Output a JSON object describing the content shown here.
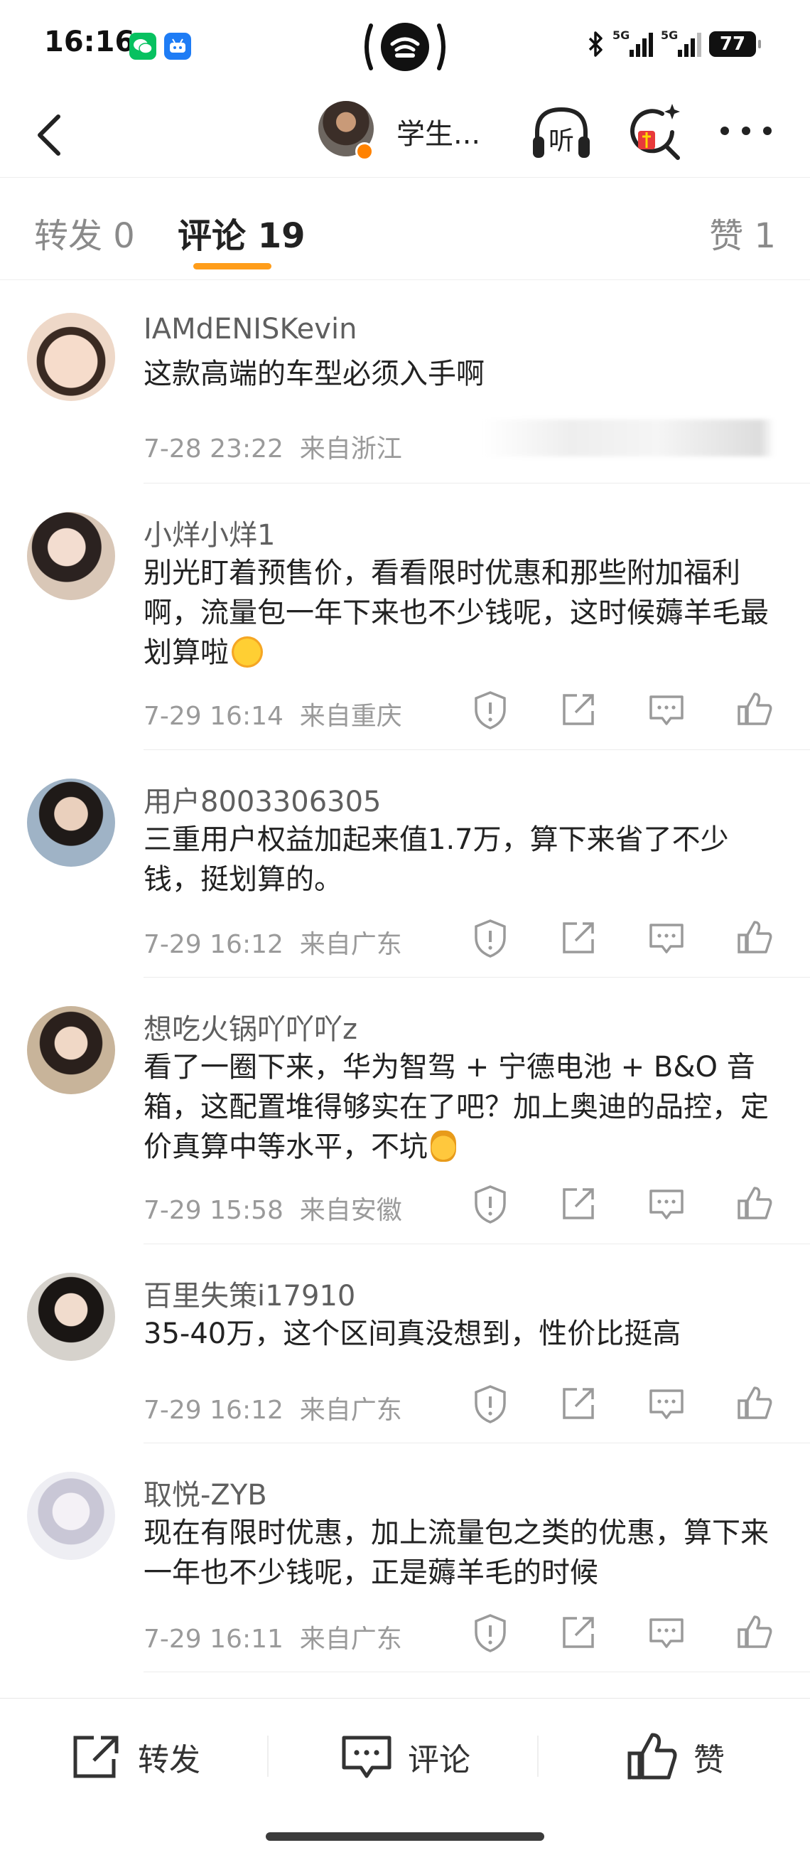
{
  "status_bar": {
    "time": "16:16",
    "network_1": "5G",
    "network_2": "5G",
    "battery": "77"
  },
  "nav": {
    "title": "学生...",
    "listen_label": "听"
  },
  "tabs": {
    "repost": "转发 0",
    "comment": "评论 19",
    "like": "赞 1"
  },
  "comments": [
    {
      "user": "IAMdENISKevin",
      "text": "这款高端的车型必须入手啊",
      "time": "7-28 23:22",
      "location": "来自浙江"
    },
    {
      "user": "小烊小烊1",
      "text": "别光盯着预售价，看看限时优惠和那些附加福利啊，流量包一年下来也不少钱呢，这时候薅羊毛最划算啦",
      "time": "7-29 16:14",
      "location": "来自重庆"
    },
    {
      "user": "用户8003306305",
      "text": "三重用户权益加起来值1.7万，算下来省了不少钱，挺划算的。",
      "time": "7-29 16:12",
      "location": "来自广东"
    },
    {
      "user": "想吃火锅吖吖吖z",
      "text": "看了一圈下来，华为智驾 + 宁德电池 + B&O 音箱，这配置堆得够实在了吧？加上奥迪的品控，定价真算中等水平，不坑",
      "time": "7-29 15:58",
      "location": "来自安徽"
    },
    {
      "user": "百里失策i17910",
      "text": "35-40万，这个区间真没想到，性价比挺高",
      "time": "7-29 16:12",
      "location": "来自广东"
    },
    {
      "user": "取悦-ZYB",
      "text": "现在有限时优惠，加上流量包之类的优惠，算下来一年也不少钱呢，正是薅羊毛的时候",
      "time": "7-29 16:11",
      "location": "来自广东"
    }
  ],
  "bottom_bar": {
    "repost": "转发",
    "comment": "评论",
    "like": "赞"
  },
  "colors": {
    "accent": "#ff9d1a",
    "name": "#5f5f5f",
    "meta": "#9a9a9a"
  }
}
